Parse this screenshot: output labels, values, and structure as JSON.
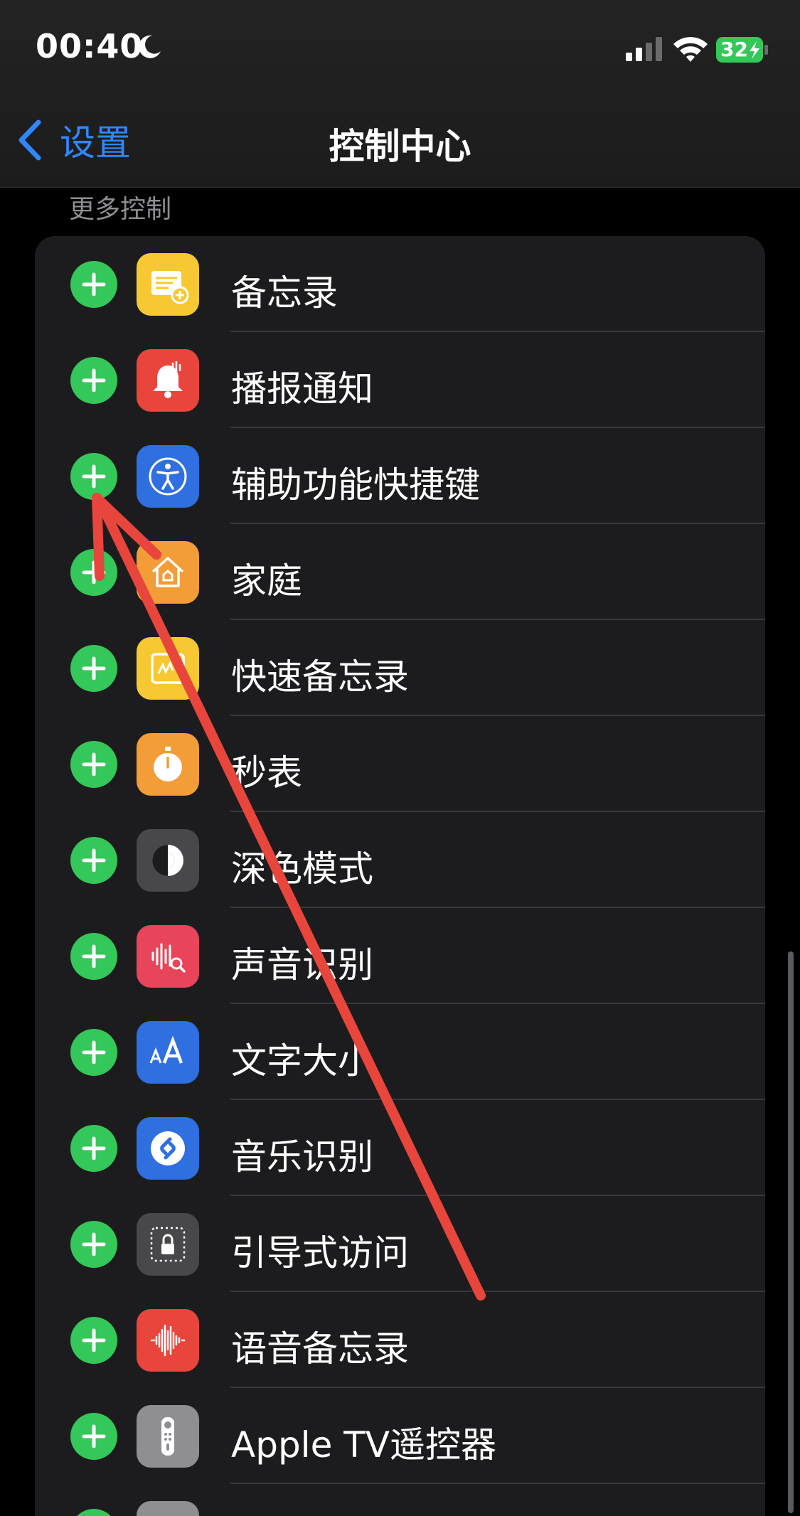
{
  "status_bar": {
    "time": "00:40",
    "battery": "32",
    "icons": [
      "moon-icon",
      "cellular-signal-icon",
      "wifi-icon",
      "battery-charging-icon"
    ]
  },
  "nav": {
    "back_label": "设置",
    "title": "控制中心"
  },
  "section": {
    "header": "更多控制",
    "items": [
      {
        "label": "备忘录",
        "icon": "notes-icon",
        "color": "#f7c832"
      },
      {
        "label": "播报通知",
        "icon": "announce-notifications-icon",
        "color": "#e8453c"
      },
      {
        "label": "辅助功能快捷键",
        "icon": "accessibility-icon",
        "color": "#2f6fe0"
      },
      {
        "label": "家庭",
        "icon": "home-icon",
        "color": "#f29d38"
      },
      {
        "label": "快速备忘录",
        "icon": "quick-note-icon",
        "color": "#f7c832"
      },
      {
        "label": "秒表",
        "icon": "stopwatch-icon",
        "color": "#f29d38"
      },
      {
        "label": "深色模式",
        "icon": "dark-mode-icon",
        "color": "#48484a"
      },
      {
        "label": "声音识别",
        "icon": "sound-recognition-icon",
        "color": "#e8445a"
      },
      {
        "label": "文字大小",
        "icon": "text-size-icon",
        "color": "#2f6fe0"
      },
      {
        "label": "音乐识别",
        "icon": "shazam-icon",
        "color": "#2f6fe0"
      },
      {
        "label": "引导式访问",
        "icon": "guided-access-icon",
        "color": "#48484a"
      },
      {
        "label": "语音备忘录",
        "icon": "voice-memos-icon",
        "color": "#e8453c"
      },
      {
        "label": "Apple TV遥控器",
        "icon": "apple-tv-remote-icon",
        "color": "#8e8e93"
      }
    ]
  },
  "colors": {
    "accent": "#2f87ff",
    "add_button": "#34c759",
    "annotation_arrow": "#e8453c"
  }
}
